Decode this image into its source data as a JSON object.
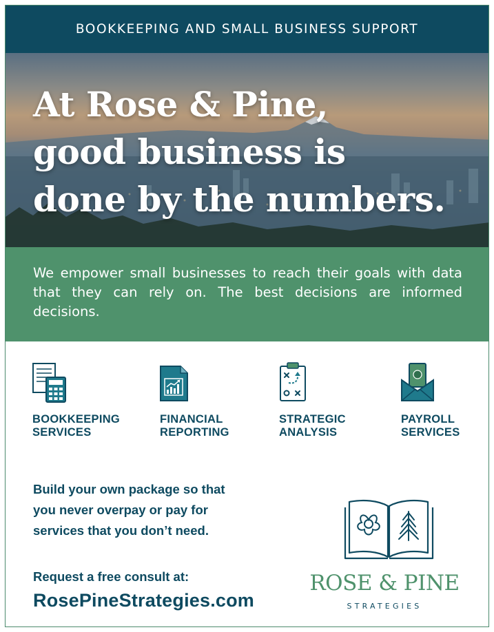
{
  "banner": {
    "text": "BOOKKEEPING AND SMALL BUSINESS SUPPORT"
  },
  "hero": {
    "headline_line1": "At Rose & Pine,",
    "headline_line2": "good business is",
    "headline_line3": "done by the numbers."
  },
  "intro": {
    "text": "We empower small businesses to reach their goals with data that they can rely on. The best decisions are informed decisions."
  },
  "services": [
    {
      "line1": "BOOKKEEPING",
      "line2": "SERVICES",
      "icon": "calculator-ledger-icon"
    },
    {
      "line1": "FINANCIAL",
      "line2": "REPORTING",
      "icon": "report-chart-icon"
    },
    {
      "line1": "STRATEGIC",
      "line2": "ANALYSIS",
      "icon": "strategy-clipboard-icon"
    },
    {
      "line1": "PAYROLL",
      "line2": "SERVICES",
      "icon": "money-envelope-icon"
    }
  ],
  "package": {
    "line1": "Build your own package so that",
    "line2": "you never overpay or pay for",
    "line3": "services that you don’t need."
  },
  "consult": {
    "prompt": "Request a free consult at:",
    "url": "RosePineStrategies.com"
  },
  "logo": {
    "name": "ROSE & PINE",
    "subtitle": "STRATEGIES",
    "icon": "open-book-rose-pine-icon"
  },
  "colors": {
    "navy": "#0e4a60",
    "green": "#4f926c",
    "teal": "#1f7a8c",
    "border": "#4c8a6c"
  }
}
